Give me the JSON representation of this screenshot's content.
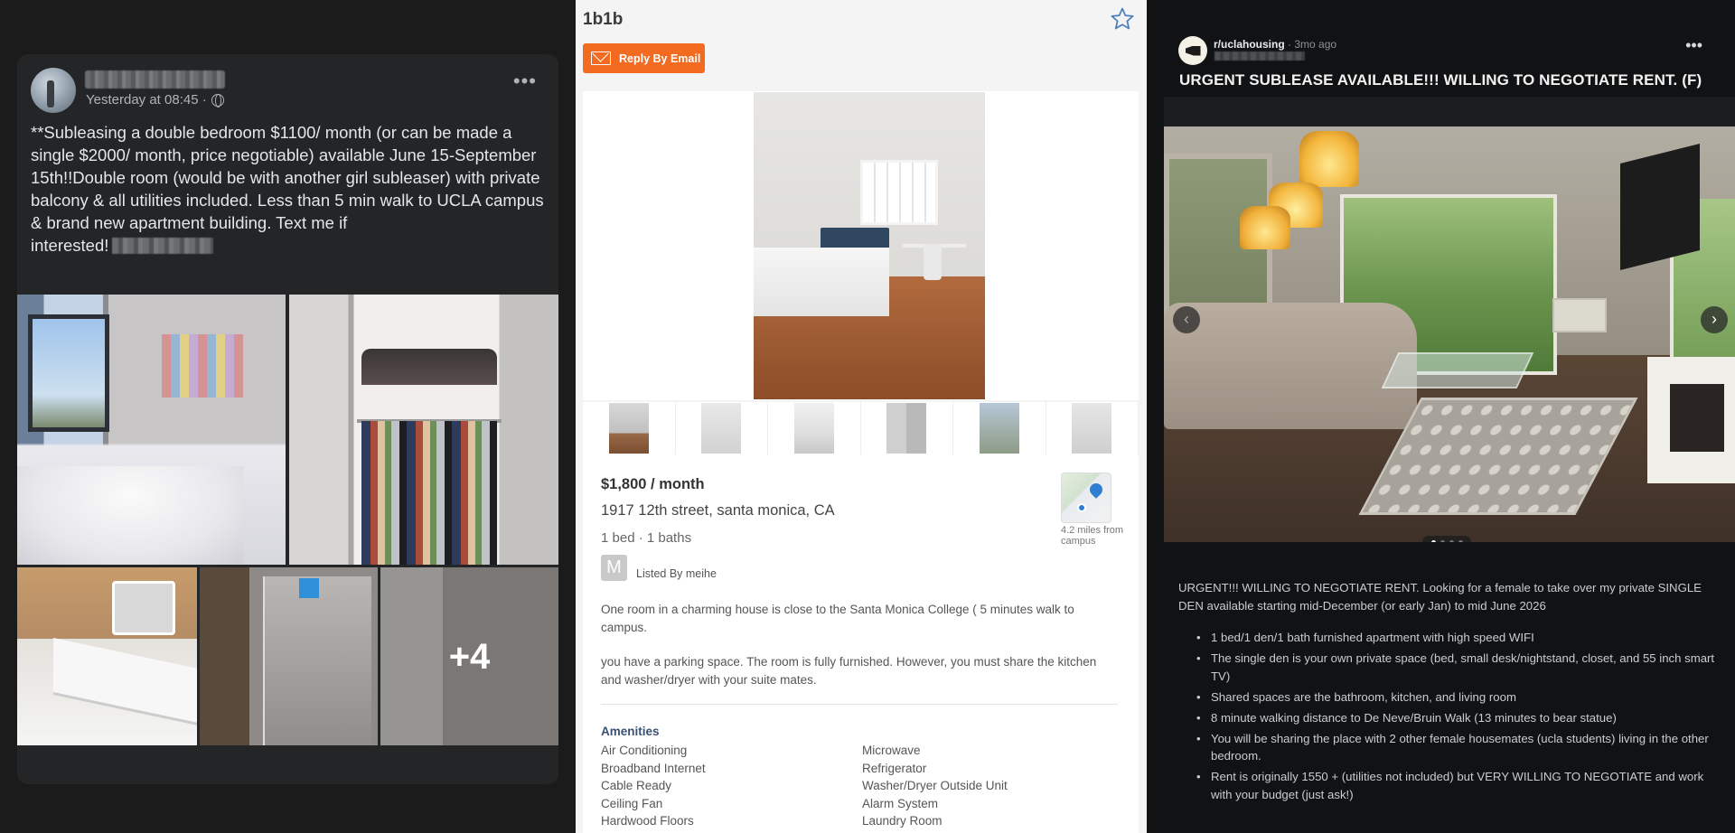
{
  "facebook": {
    "timestamp": "Yesterday at 08:45 ·",
    "post_text": "**Subleasing a double bedroom $1100/ month (or can be made a single $2000/ month, price negotiable) available June 15-September 15th!!Double room (would be with another girl subleaser) with private balcony & all utilities included. Less than 5 min walk to UCLA campus & brand new apartment building. Text me if\ninterested!",
    "more_photos": "+4",
    "more_icon": "ellipsis-icon",
    "privacy_icon": "globe-icon"
  },
  "listing": {
    "title": "1b1b",
    "reply_label": "Reply By Email",
    "price": "$1,800 / month",
    "address": "1917 12th street, santa monica, CA",
    "beds_baths": "1 bed · 1 baths",
    "avatar_letter": "M",
    "listed_by": "Listed By meihe",
    "distance": "4.2 miles from campus",
    "description_1": "One room in a charming house is close to the Santa Monica College ( 5 minutes walk to campus.",
    "description_2": "you have a parking space. The room is fully furnished. However, you must share the kitchen and washer/dryer with your suite mates.",
    "amenities_title": "Amenities",
    "amenities_left": [
      "Air Conditioning",
      "Broadband Internet",
      "Cable Ready",
      "Ceiling Fan",
      "Hardwood Floors"
    ],
    "amenities_right": [
      "Microwave",
      "Refrigerator",
      "Washer/Dryer Outside Unit",
      "Alarm System",
      "Laundry Room"
    ],
    "accent_color": "#f26b21"
  },
  "reddit": {
    "subreddit": "r/uclahousing",
    "age": "· 3mo ago",
    "title": "URGENT SUBLEASE AVAILABLE!!! WILLING TO NEGOTIATE RENT. (F)",
    "body": "URGENT!!! WILLING TO NEGOTIATE RENT. Looking for a female to take over my private SINGLE DEN available starting mid-December (or early Jan) to mid June 2026",
    "bullets": [
      "1 bed/1 den/1 bath furnished apartment with high speed WIFI",
      "The single den is your own private space (bed, small desk/nightstand, closet, and 55 inch smart TV)",
      "Shared spaces are the bathroom, kitchen, and living room",
      "8 minute walking distance to De Neve/Bruin Walk (13 minutes to bear statue)",
      "You will be sharing the place with 2 other female housemates (ucla students) living in the other bedroom.",
      "Rent is originally 1550 + (utilities not included) but VERY WILLING TO NEGOTIATE and work with your budget (just ask!)"
    ],
    "prev_arrow": "‹",
    "next_arrow": "›",
    "carousel_position": 1,
    "carousel_count": 4
  }
}
